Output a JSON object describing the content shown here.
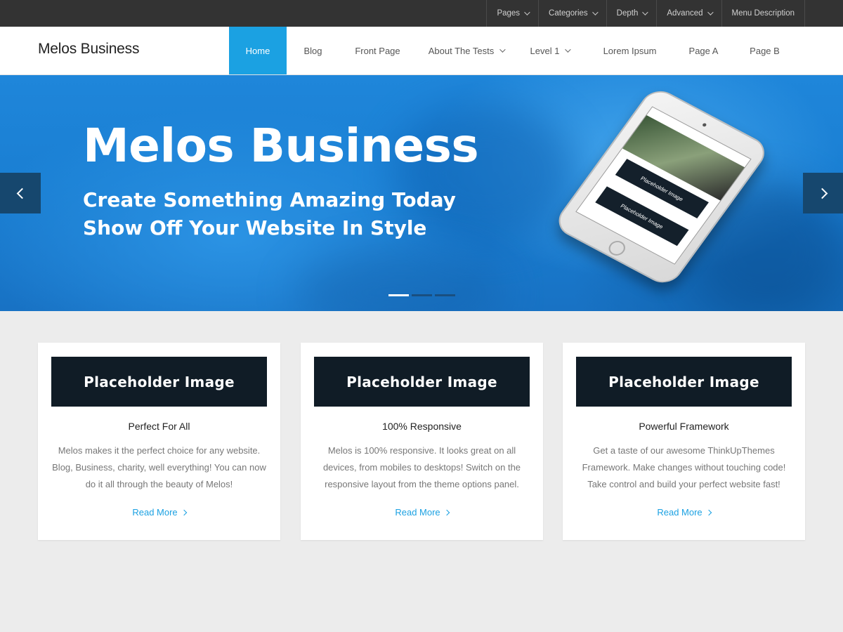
{
  "topbar": {
    "menu": [
      {
        "label": "Pages",
        "has_dropdown": true
      },
      {
        "label": "Categories",
        "has_dropdown": true
      },
      {
        "label": "Depth",
        "has_dropdown": true
      },
      {
        "label": "Advanced",
        "has_dropdown": true
      },
      {
        "label": "Menu Description",
        "has_dropdown": false
      }
    ]
  },
  "header": {
    "site_title": "Melos Business",
    "nav": [
      {
        "label": "Home",
        "active": true
      },
      {
        "label": "Blog"
      },
      {
        "label": "Front Page"
      },
      {
        "label": "About The Tests",
        "has_dropdown": true
      },
      {
        "label": "Level 1",
        "has_dropdown": true
      },
      {
        "label": "Lorem Ipsum"
      },
      {
        "label": "Page A"
      },
      {
        "label": "Page B"
      }
    ]
  },
  "hero": {
    "title": "Melos Business",
    "subtitle_line1": "Create Something Amazing Today",
    "subtitle_line2": "Show Off Your Website In Style",
    "phone_placeholder": "Placeholder Image",
    "slide_count": 3,
    "active_slide": 1
  },
  "features": [
    {
      "image_label": "Placeholder Image",
      "title": "Perfect For All",
      "text": "Melos makes it the perfect choice for any website. Blog, Business, charity, well everything! You can now do it all through the beauty of Melos!",
      "link": "Read More"
    },
    {
      "image_label": "Placeholder Image",
      "title": "100% Responsive",
      "text": "Melos is 100% responsive. It looks great on all devices, from mobiles to desktops! Switch on the responsive layout from the theme options panel.",
      "link": "Read More"
    },
    {
      "image_label": "Placeholder Image",
      "title": "Powerful Framework",
      "text": "Get a taste of our awesome ThinkUpThemes Framework. Make changes without touching code! Take control and build your perfect website fast!",
      "link": "Read More"
    }
  ],
  "colors": {
    "accent": "#1ba1e2",
    "topbar_bg": "#333333",
    "page_bg": "#ececec",
    "placeholder_bg": "#101c26"
  }
}
